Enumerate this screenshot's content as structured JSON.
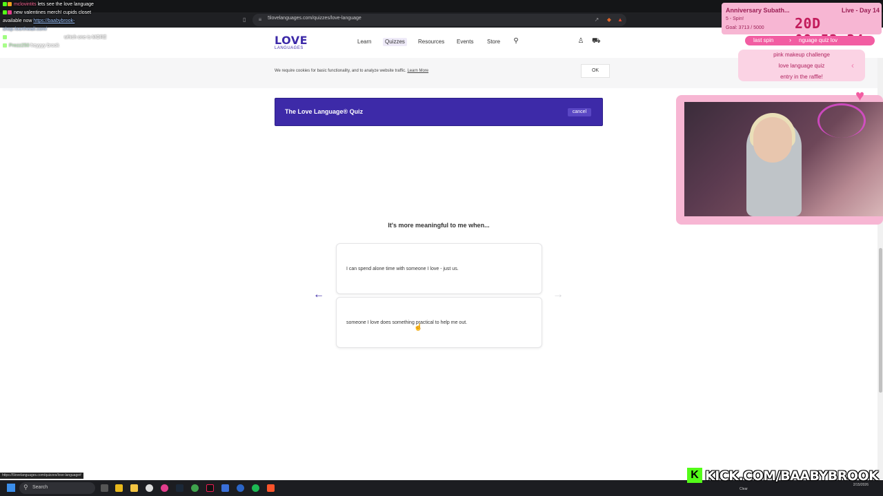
{
  "browser": {
    "url": "5lovelanguages.com/quizzes/love-language"
  },
  "header": {
    "logo_main": "LOVE",
    "logo_sub": "LANGUAGES",
    "nav": [
      {
        "label": "Learn"
      },
      {
        "label": "Quizzes"
      },
      {
        "label": "Resources"
      },
      {
        "label": "Events"
      },
      {
        "label": "Store"
      }
    ]
  },
  "cookie": {
    "text": "We require cookies for basic functionality, and to analyze website traffic.",
    "link": "Learn More",
    "ok_label": "OK"
  },
  "quiz": {
    "title": "The Love Language® Quiz",
    "cancel_label": "cancel",
    "question": "It's more meaningful to me when...",
    "options": [
      {
        "text": "I can spend alone time with someone I love - just us."
      },
      {
        "text": "someone I love does something practical to help me out."
      }
    ],
    "prev_arrow": "←",
    "next_arrow": "→"
  },
  "status_link": "https://5lovelanguages.com/quizzes/love-language#",
  "taskbar": {
    "search_label": "Search",
    "weather": "Clear",
    "time": "",
    "date": "2/15/2026"
  },
  "overlay": {
    "chat": [
      {
        "user": "mclovintits",
        "text": "lets see the love language"
      },
      {
        "user": "",
        "text": "new valentines merch! cupids closet"
      },
      {
        "user": "",
        "text": "available now",
        "link": "https://baabybrook-"
      },
      {
        "user": "",
        "text": "shop.fourthwall.com/"
      },
      {
        "user": "",
        "text": "which one is MORE"
      },
      {
        "user": "Prezz250",
        "text": "heyyyy brook"
      }
    ],
    "sub_goal": {
      "title": "Anniversary Subath...",
      "spin": "5 - Spin!",
      "goal": "Goal: 3713 / 5000",
      "live": "Live - Day 14",
      "timer": "20D 09:52:34"
    },
    "last_spin": {
      "label": "last spin",
      "chevron": "›",
      "value": "nguage quiz lov"
    },
    "wheel": [
      "pink makeup challenge",
      "love language quiz",
      "entry in the raffle!"
    ],
    "wheel_chevron": "‹",
    "kick": {
      "logo": "K",
      "text": "KICK.COM/BAABYBROOK"
    }
  },
  "colors": {
    "brand": "#3d2aa8",
    "overlay_pink": "#f7b6d3",
    "kick_green": "#53fc18"
  }
}
